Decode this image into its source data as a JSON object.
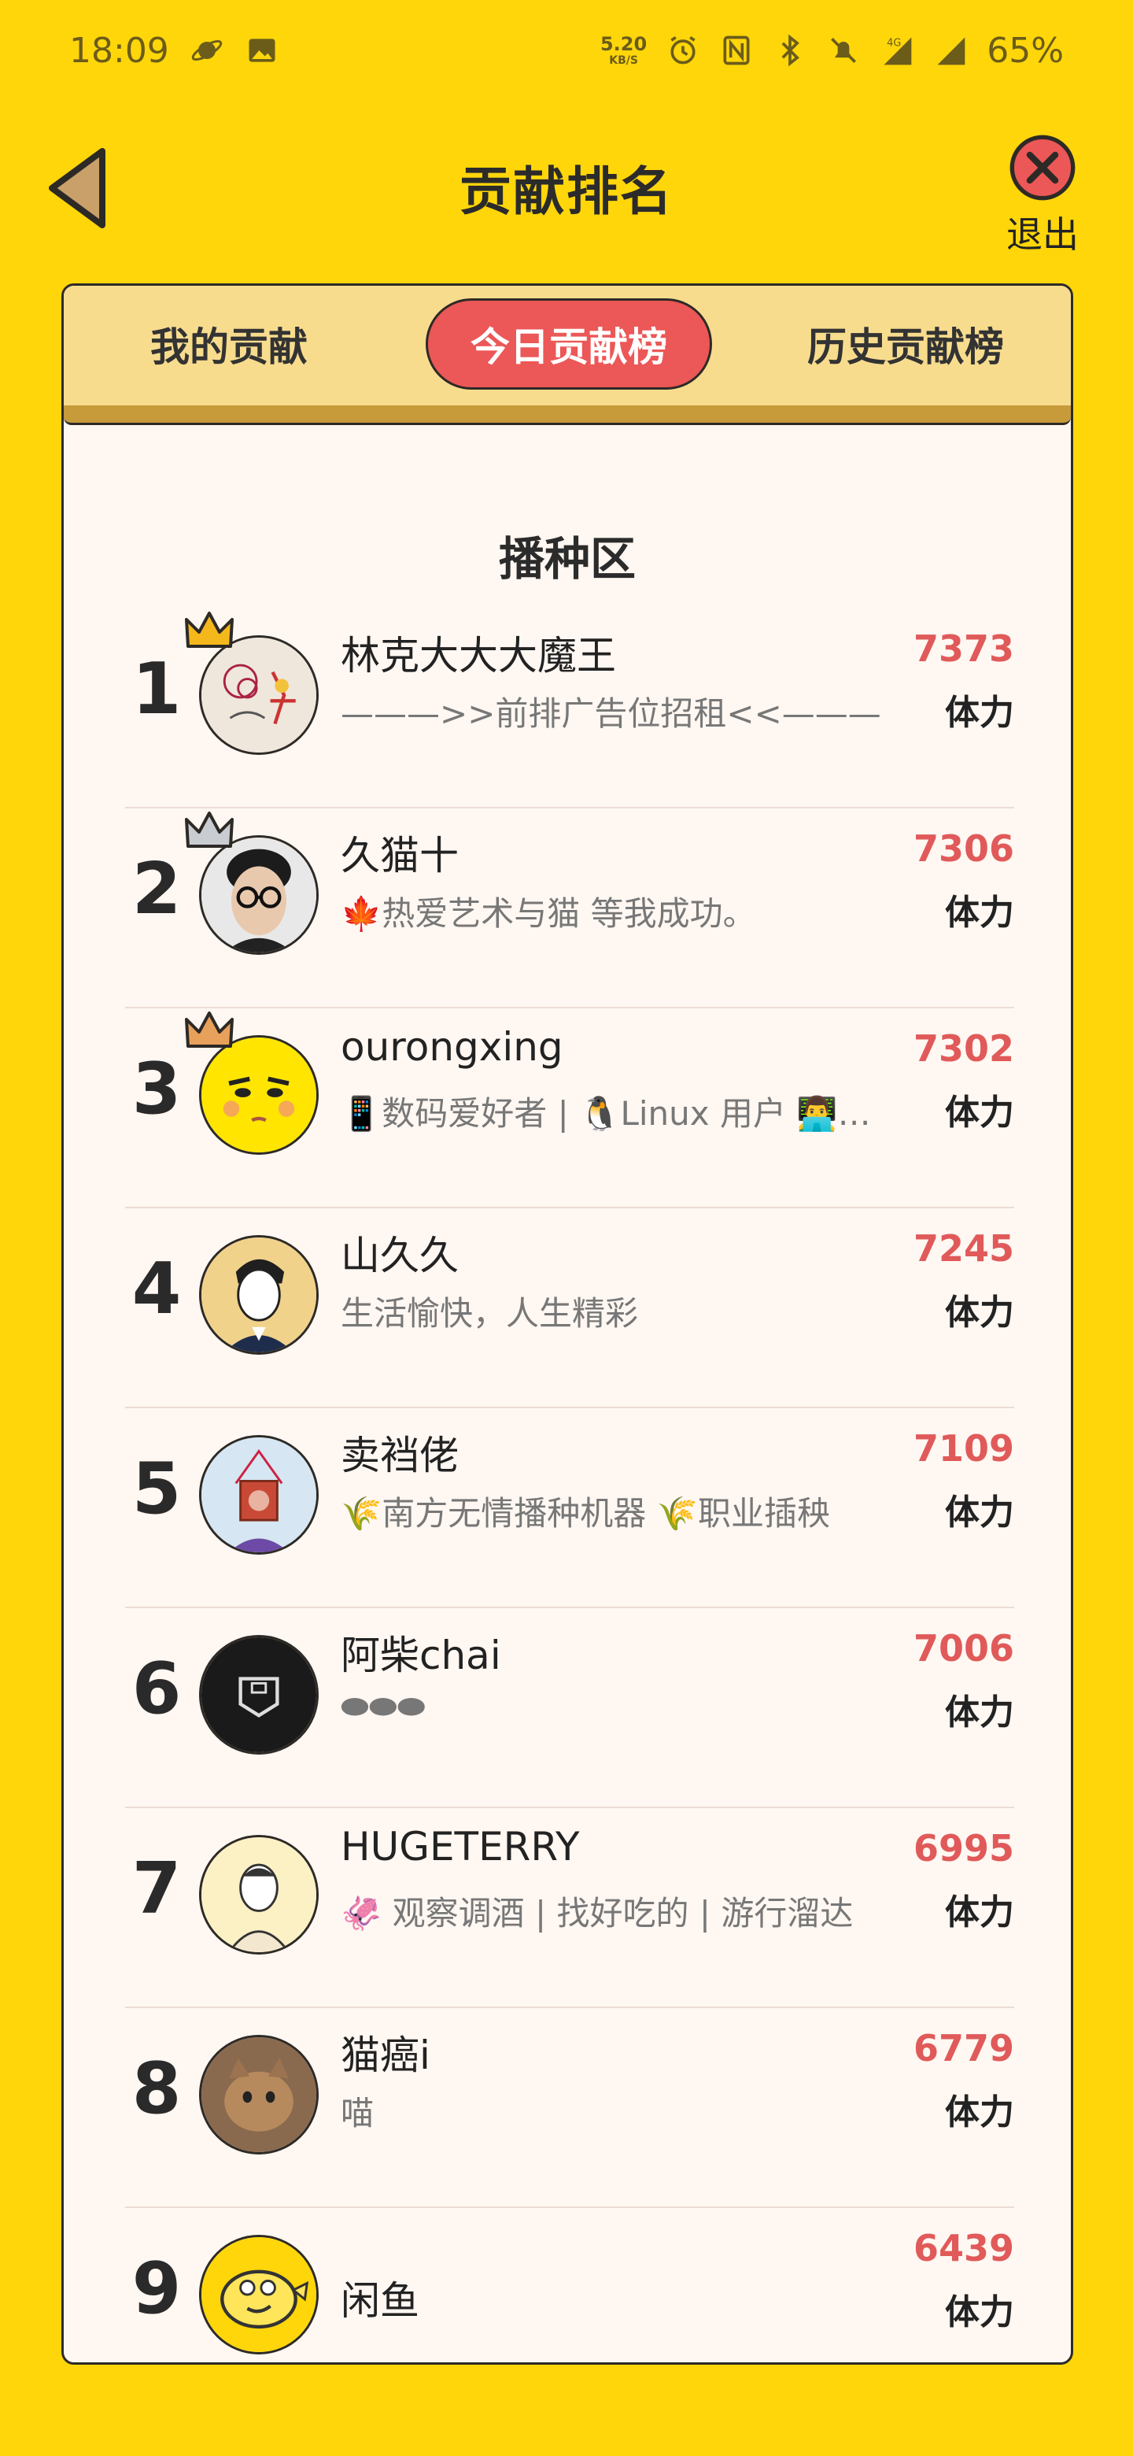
{
  "status_bar": {
    "time": "18:09",
    "net_speed_value": "5.20",
    "net_speed_unit": "KB/S",
    "network_type": "4G",
    "battery": "65%"
  },
  "header": {
    "title": "贡献排名",
    "exit_label": "退出"
  },
  "tabs": [
    {
      "label": "我的贡献",
      "active": false
    },
    {
      "label": "今日贡献榜",
      "active": true
    },
    {
      "label": "历史贡献榜",
      "active": false
    }
  ],
  "section_title": "播种区",
  "rankings": [
    {
      "rank": "1",
      "name": "林克大大大魔王",
      "bio": "———>>前排广告位招租<<———",
      "score": "7373",
      "unit": "体力",
      "crown": "gold"
    },
    {
      "rank": "2",
      "name": "久猫十",
      "bio": "🍁热爱艺术与猫 等我成功。",
      "score": "7306",
      "unit": "体力",
      "crown": "silver"
    },
    {
      "rank": "3",
      "name": "ourongxing",
      "bio": "📱数码爱好者 | 🐧Linux 用户 👨‍💻程序员",
      "score": "7302",
      "unit": "体力",
      "crown": "bronze"
    },
    {
      "rank": "4",
      "name": "山久久",
      "bio": "生活愉快，人生精彩",
      "score": "7245",
      "unit": "体力"
    },
    {
      "rank": "5",
      "name": "卖裆佬",
      "bio": "🌾南方无情播种机器 🌾职业插秧",
      "score": "7109",
      "unit": "体力"
    },
    {
      "rank": "6",
      "name": "阿柴chai",
      "bio": "⬬⬬⬬",
      "score": "7006",
      "unit": "体力"
    },
    {
      "rank": "7",
      "name": "HUGETERRY",
      "bio": "🦑 观察调酒 | 找好吃的 | 游行溜达",
      "score": "6995",
      "unit": "体力"
    },
    {
      "rank": "8",
      "name": "猫癌i",
      "bio": "喵",
      "score": "6779",
      "unit": "体力"
    },
    {
      "rank": "9",
      "name": "闲鱼",
      "bio": "",
      "score": "6439",
      "unit": "体力"
    }
  ],
  "colors": {
    "background": "#FFD60A",
    "active_tab": "#EC5757",
    "score": "#E05A5A",
    "card": "#FFF7F2",
    "tab_bar": "#F8DC8E"
  }
}
